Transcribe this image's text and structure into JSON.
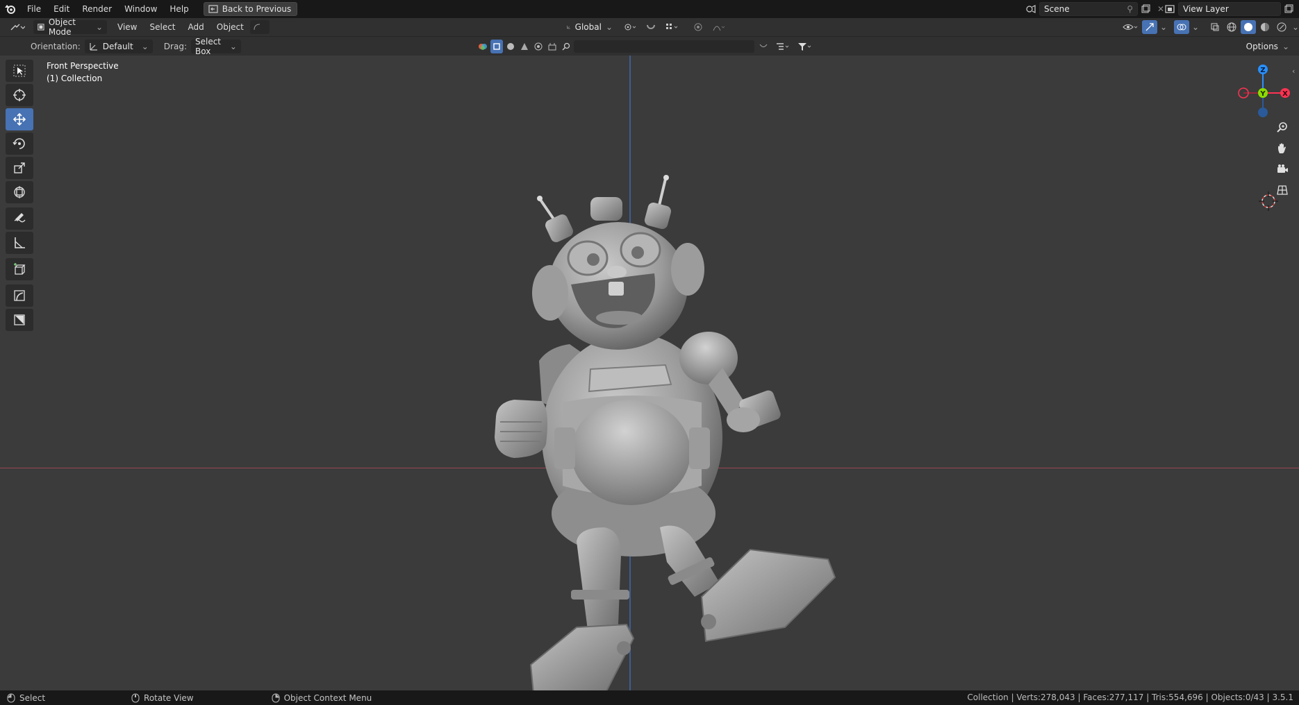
{
  "menubar": {
    "items": [
      "File",
      "Edit",
      "Render",
      "Window",
      "Help"
    ],
    "back_button": "Back to Previous",
    "scene_name": "Scene",
    "view_layer_name": "View Layer"
  },
  "header": {
    "mode": "Object Mode",
    "menus": [
      "View",
      "Select",
      "Add",
      "Object"
    ],
    "transform_orientation": "Global",
    "options_label": "Options"
  },
  "tool_settings": {
    "orientation_label": "Orientation:",
    "orientation_value": "Default",
    "drag_label": "Drag:",
    "drag_value": "Select Box"
  },
  "viewport": {
    "title": "Front Perspective",
    "collection": "(1) Collection"
  },
  "gizmo": {
    "z_label": "Z",
    "y_label": "Y",
    "x_label": "X"
  },
  "statusbar": {
    "select": "Select",
    "rotate_view": "Rotate View",
    "context_menu": "Object Context Menu",
    "stats": "Collection | Verts:278,043 | Faces:277,117 | Tris:554,696 | Objects:0/43 | 3.5.1"
  },
  "colors": {
    "accent": "#4772b3",
    "x_axis": "#ff3352",
    "y_axis": "#8bdc00",
    "z_axis": "#2890ff",
    "viewport_bg": "#3b3b3b"
  }
}
